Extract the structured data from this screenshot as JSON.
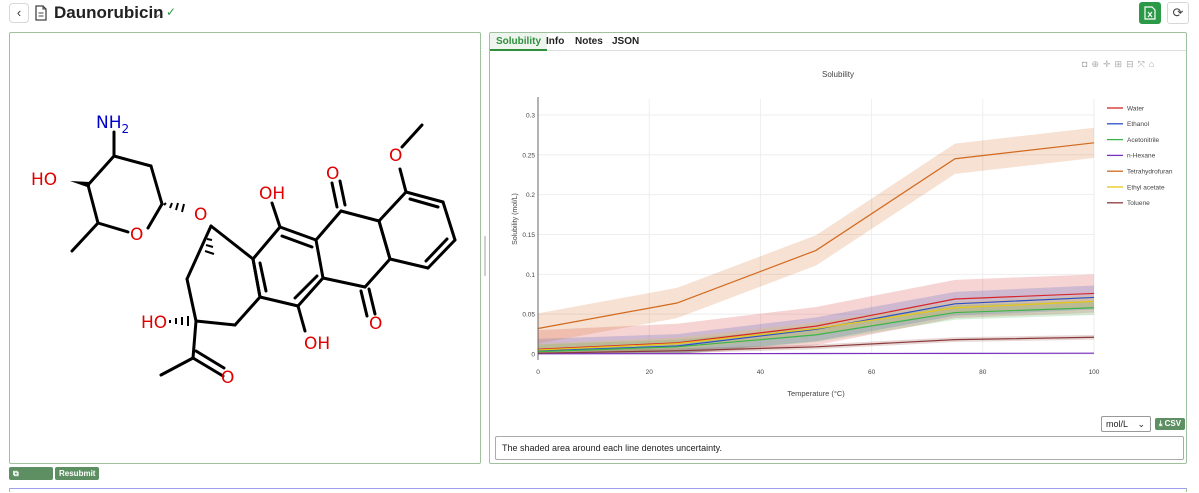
{
  "header": {
    "back_icon": "chevron-left-icon",
    "doc_icon": "document-icon",
    "title": "Daunorubicin",
    "dropdown_icon": "chevron-down-icon",
    "verified_icon": "check-icon",
    "export_icon": "spreadsheet-icon",
    "refresh_icon": "refresh-icon",
    "accent": "#2b9a48"
  },
  "molecule": {
    "labels": {
      "nh2": "NH2",
      "ho_sugar": "HO",
      "o_ring": "O",
      "o_link": "O",
      "oh_top": "OH",
      "o_quinone_top": "O",
      "o_methoxy": "O",
      "ho_ring_a": "HO",
      "oh_bottom": "OH",
      "o_quinone_bottom": "O",
      "o_acetyl": "O"
    },
    "buttons": {
      "smiles": "SMILES",
      "resubmit": "Resubmit"
    }
  },
  "tabs": [
    {
      "label": "Solubility",
      "active": true
    },
    {
      "label": "Info",
      "active": false
    },
    {
      "label": "Notes",
      "active": false
    },
    {
      "label": "JSON",
      "active": false
    }
  ],
  "unit_select": "mol/L",
  "csv_label": "CSV",
  "note": "The shaded area around each line denotes uncertainty.",
  "chart_data": {
    "type": "line",
    "title": "Solubility",
    "xlabel": "Temperature (°C)",
    "ylabel": "Solubility (mol/L)",
    "xlim": [
      0,
      100
    ],
    "ylim": [
      0,
      0.32
    ],
    "x_ticks": [
      "0",
      "20",
      "40",
      "60",
      "80",
      "100"
    ],
    "y_ticks": [
      "0",
      "0.05",
      "0.1",
      "0.15",
      "0.2",
      "0.25",
      "0.3"
    ],
    "x": [
      0,
      25,
      50,
      75,
      100
    ],
    "legend_position": "top-right",
    "series": [
      {
        "name": "Water",
        "color": "#d62728",
        "values": [
          0.006,
          0.014,
          0.035,
          0.069,
          0.076
        ],
        "band": 0.048
      },
      {
        "name": "Ethanol",
        "color": "#2c4fc9",
        "values": [
          0.004,
          0.01,
          0.031,
          0.063,
          0.071
        ],
        "band": 0.03
      },
      {
        "name": "Acetonitrile",
        "color": "#3cb44b",
        "values": [
          0.003,
          0.009,
          0.024,
          0.052,
          0.058
        ],
        "band": 0.018
      },
      {
        "name": "n-Hexane",
        "color": "#7b2fbf",
        "values": [
          0.0003,
          0.0004,
          0.0006,
          0.0008,
          0.001
        ],
        "band": 0.001
      },
      {
        "name": "Tetrahydrofuran",
        "color": "#d2691e",
        "values": [
          0.032,
          0.064,
          0.13,
          0.245,
          0.265
        ],
        "band": 0.038
      },
      {
        "name": "Ethyl acetate",
        "color": "#e6c619",
        "values": [
          0.005,
          0.013,
          0.032,
          0.058,
          0.066
        ],
        "band": 0.015
      },
      {
        "name": "Toluene",
        "color": "#8b3a3a",
        "values": [
          0.001,
          0.004,
          0.009,
          0.018,
          0.021
        ],
        "band": 0.006
      }
    ]
  }
}
